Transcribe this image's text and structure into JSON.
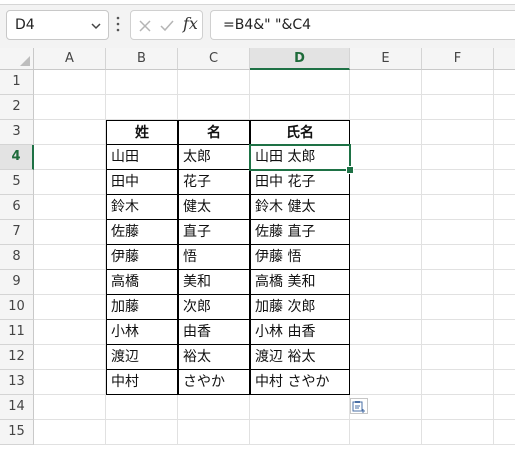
{
  "name_box": {
    "value": "D4"
  },
  "formula_bar": {
    "fx_label": "fx",
    "formula": "=B4&\" \"&C4"
  },
  "columns": [
    "A",
    "B",
    "C",
    "D",
    "E",
    "F"
  ],
  "rows": [
    "1",
    "2",
    "3",
    "4",
    "5",
    "6",
    "7",
    "8",
    "9",
    "10",
    "11",
    "12",
    "13",
    "14",
    "15"
  ],
  "table": {
    "headers": [
      "姓",
      "名",
      "氏名"
    ],
    "rows": [
      [
        "山田",
        "太郎",
        "山田 太郎"
      ],
      [
        "田中",
        "花子",
        "田中 花子"
      ],
      [
        "鈴木",
        "健太",
        "鈴木 健太"
      ],
      [
        "佐藤",
        "直子",
        "佐藤 直子"
      ],
      [
        "伊藤",
        "悟",
        "伊藤 悟"
      ],
      [
        "高橋",
        "美和",
        "高橋 美和"
      ],
      [
        "加藤",
        "次郎",
        "加藤 次郎"
      ],
      [
        "小林",
        "由香",
        "小林 由香"
      ],
      [
        "渡辺",
        "裕太",
        "渡辺 裕太"
      ],
      [
        "中村",
        "さやか",
        "中村 さやか"
      ]
    ]
  },
  "selection": {
    "column": "D",
    "row": "4"
  },
  "colors": {
    "accent": "#1e7145",
    "header_bg": "#f5f5f5",
    "selected_header_bg": "#e3e3e3"
  },
  "icons": {
    "name_box_dropdown": "chevron-down-icon",
    "more": "vertical-dots-icon",
    "cancel": "cancel-x-icon",
    "enter": "checkmark-icon",
    "paste_options": "paste-options-icon"
  }
}
